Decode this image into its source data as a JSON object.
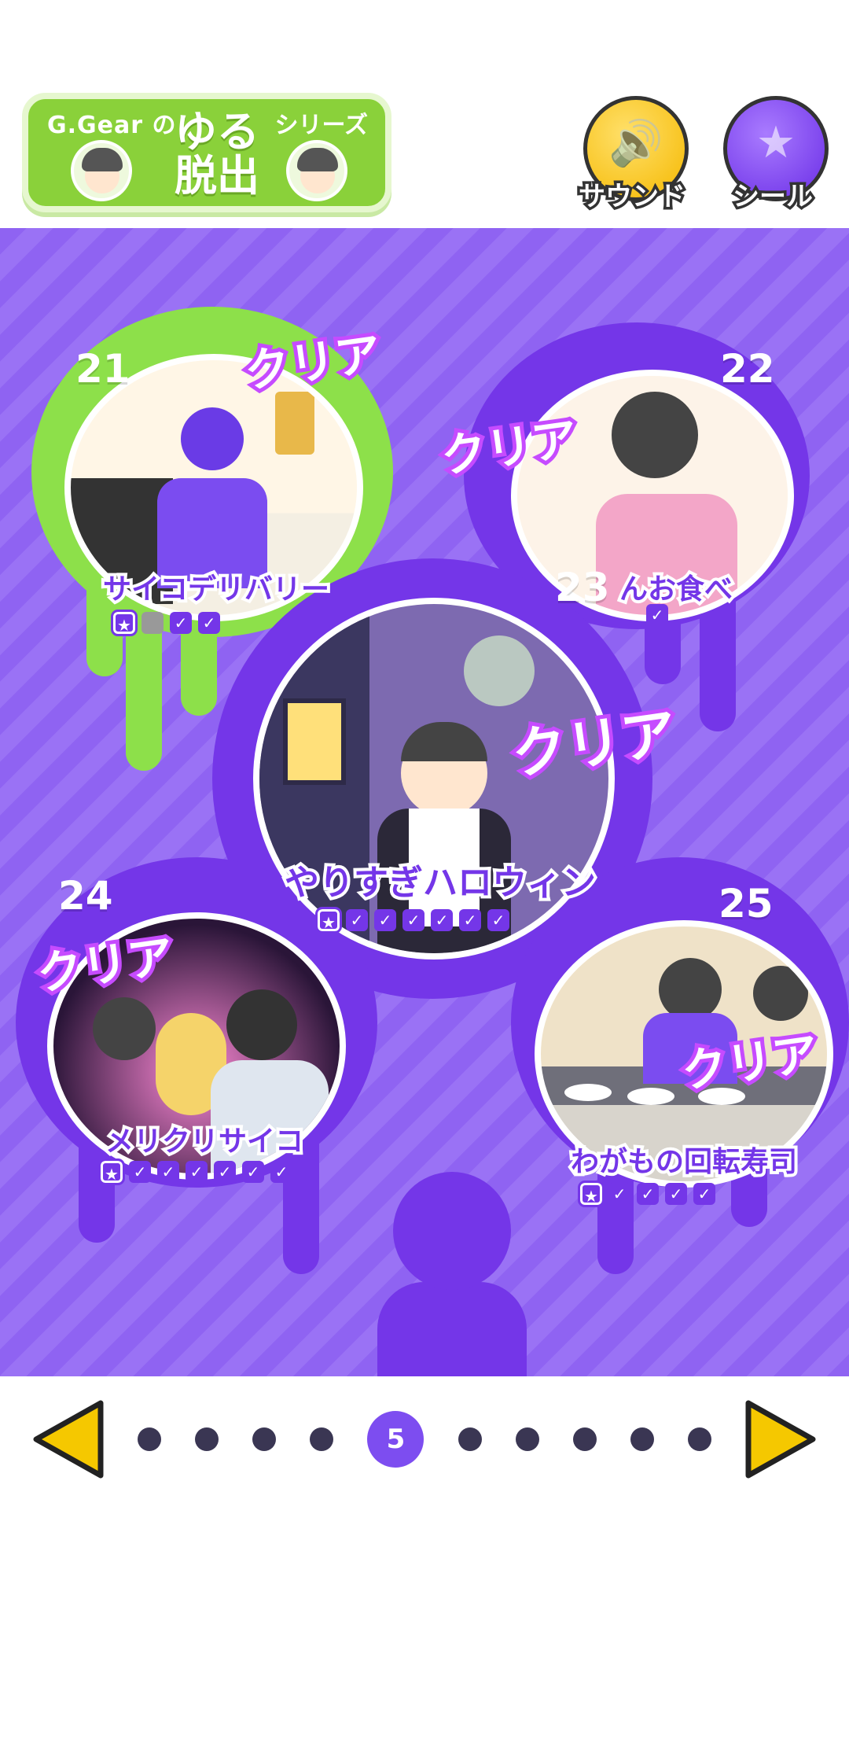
{
  "header": {
    "logo": {
      "brand": "G.Gear の",
      "title_line1": "ゆる",
      "title_line2": "脱出",
      "series": "シリーズ"
    },
    "sound_label": "サウンド",
    "seal_label": "シール"
  },
  "levels": [
    {
      "number": "21",
      "title": "サイコデリバリー",
      "badge": "クリア",
      "checks": [
        "star",
        "empty",
        "check",
        "check"
      ]
    },
    {
      "number": "22",
      "title": "んお食べ",
      "badge": "クリア",
      "checks": [
        "check"
      ]
    },
    {
      "number": "23",
      "title": "やりすぎハロウィン",
      "badge": "クリア",
      "checks": [
        "star",
        "check",
        "check",
        "check",
        "check",
        "check",
        "check"
      ]
    },
    {
      "number": "24",
      "title": "メリクリサイコ",
      "badge": "クリア",
      "checks": [
        "star",
        "check",
        "check",
        "check",
        "check",
        "check",
        "check"
      ]
    },
    {
      "number": "25",
      "title": "わがもの回転寿司",
      "badge": "クリア",
      "checks": [
        "star",
        "check",
        "check",
        "check",
        "check"
      ]
    }
  ],
  "pagination": {
    "current_page": "5",
    "total_pages": 10
  },
  "colors": {
    "purple": "#7436e8",
    "green": "#8de04a",
    "yellow": "#f5c800"
  },
  "icons": {
    "sound": "speaker-icon",
    "seal": "star-sticker-icon",
    "prev": "left-arrow-icon",
    "next": "right-arrow-icon"
  }
}
